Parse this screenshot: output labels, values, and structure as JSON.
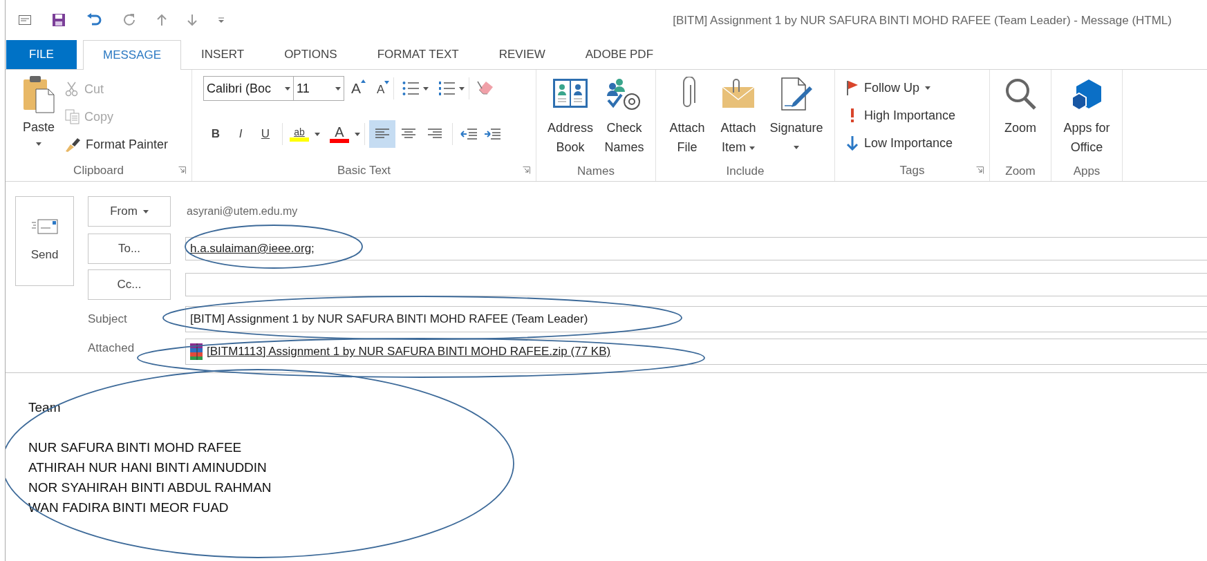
{
  "window": {
    "title": "[BITM] Assignment 1 by NUR SAFURA BINTI MOHD RAFEE (Team Leader) - Message (HTML)"
  },
  "tabs": [
    {
      "label": "FILE",
      "kind": "file",
      "selected": false
    },
    {
      "label": "MESSAGE",
      "kind": "tab",
      "selected": true
    },
    {
      "label": "INSERT",
      "kind": "tab",
      "selected": false
    },
    {
      "label": "OPTIONS",
      "kind": "tab",
      "selected": false
    },
    {
      "label": "FORMAT TEXT",
      "kind": "tab",
      "selected": false
    },
    {
      "label": "REVIEW",
      "kind": "tab",
      "selected": false
    },
    {
      "label": "ADOBE PDF",
      "kind": "tab",
      "selected": false
    }
  ],
  "ribbon": {
    "clipboard": {
      "label": "Clipboard",
      "launcher": true,
      "paste": "Paste",
      "items": [
        {
          "label": "Cut",
          "kind": "cut",
          "disabled": true
        },
        {
          "label": "Copy",
          "kind": "copy",
          "disabled": true
        },
        {
          "label": "Format Painter",
          "kind": "painter",
          "disabled": false
        }
      ]
    },
    "basic_text": {
      "label": "Basic Text",
      "launcher": true,
      "font": "Calibri (Boc",
      "size": "11",
      "grow_font": "A",
      "shrink_font": "A",
      "styles": [
        "B",
        "I",
        "U"
      ],
      "highlight": "ab",
      "font_color": "A",
      "alignments": [
        {
          "kind": "left",
          "selected": true
        },
        {
          "kind": "center",
          "selected": false
        },
        {
          "kind": "right",
          "selected": false
        }
      ]
    },
    "names": {
      "label": "Names",
      "buttons": [
        {
          "label": "Address Book",
          "kind": "address_book"
        },
        {
          "label": "Check Names",
          "kind": "check_names"
        }
      ]
    },
    "include": {
      "label": "Include",
      "buttons": [
        {
          "label": "Attach File",
          "kind": "attach_file",
          "dropdown": false
        },
        {
          "label": "Attach Item",
          "kind": "attach_item",
          "dropdown": true
        },
        {
          "label": "Signature",
          "kind": "signature",
          "dropdown": true
        }
      ]
    },
    "tags": {
      "label": "Tags",
      "launcher": true,
      "items": [
        {
          "label": "Follow Up",
          "kind": "follow_up",
          "dropdown": true
        },
        {
          "label": "High Importance",
          "kind": "high",
          "dropdown": false
        },
        {
          "label": "Low Importance",
          "kind": "low",
          "dropdown": false
        }
      ]
    },
    "zoom": {
      "label": "Zoom",
      "button": "Zoom"
    },
    "apps": {
      "label": "Apps",
      "button": "Apps for Office"
    }
  },
  "message": {
    "send": "Send",
    "from": {
      "button": "From",
      "value": "asyrani@utem.edu.my"
    },
    "to": {
      "button": "To...",
      "value": "h.a.sulaiman@ieee.org;"
    },
    "cc": {
      "button": "Cc..."
    },
    "subject": {
      "label": "Subject",
      "value": "[BITM] Assignment 1 by NUR SAFURA BINTI MOHD RAFEE (Team Leader)"
    },
    "attached": {
      "label": "Attached",
      "file": "[BITM1113] Assignment 1 by NUR SAFURA BINTI MOHD RAFEE.zip (77 KB)"
    }
  },
  "body": {
    "paragraphs": [
      [
        "Team"
      ],
      [
        "NUR SAFURA BINTI MOHD RAFEE",
        "ATHIRAH NUR HANI BINTI AMINUDDIN",
        "NOR SYAHIRAH BINTI ABDUL RAHMAN",
        "WAN FADIRA BINTI MEOR FUAD"
      ]
    ]
  }
}
